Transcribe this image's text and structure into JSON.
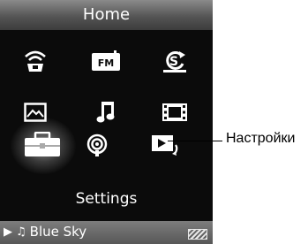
{
  "screen": {
    "title": "Home",
    "selected_label": "Settings",
    "now_playing": "Blue Sky",
    "menu_icons": [
      {
        "name": "wireless-icon"
      },
      {
        "name": "fm-radio-icon",
        "text": "FM"
      },
      {
        "name": "podcast-icon"
      },
      {
        "name": "photo-icon"
      },
      {
        "name": "music-note-icon"
      },
      {
        "name": "video-icon"
      },
      {
        "name": "settings-toolbox-icon"
      },
      {
        "name": "podcast-broadcast-icon"
      },
      {
        "name": "playback-return-icon"
      }
    ]
  },
  "callout": {
    "label": "Настройки"
  },
  "colors": {
    "background": "#0b0b0b",
    "titlebar": "#5a5a5a",
    "icon": "#ffffff"
  }
}
